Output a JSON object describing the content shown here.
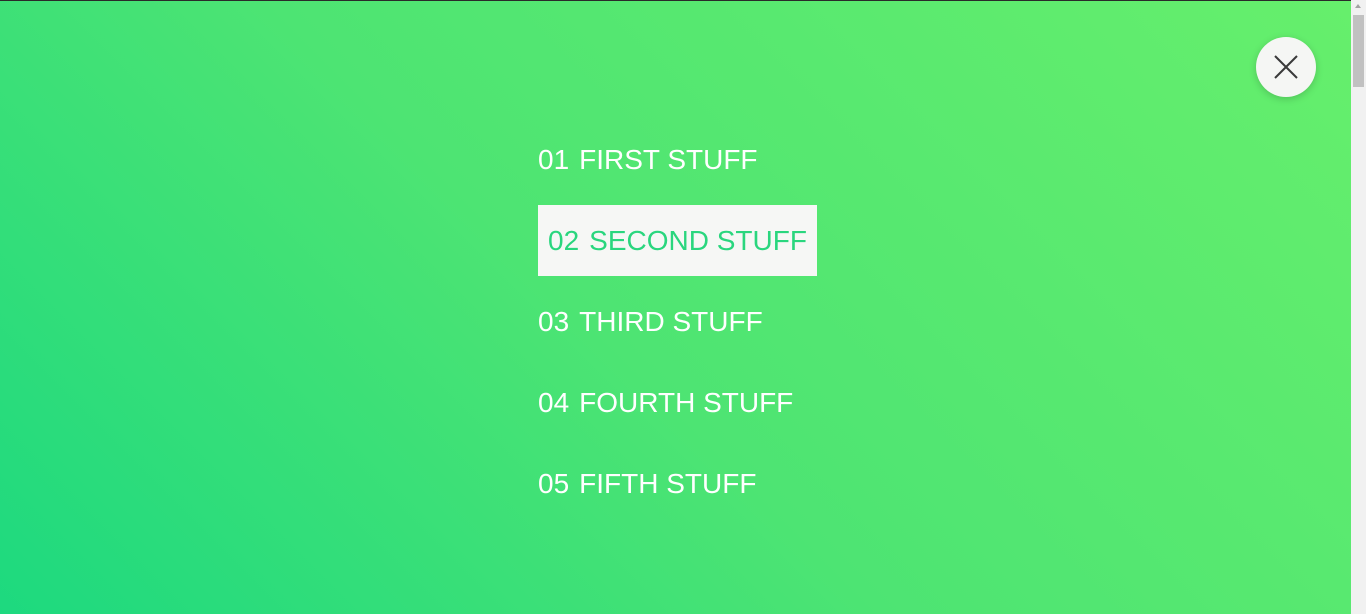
{
  "close": {
    "icon": "close-icon"
  },
  "menu": {
    "items": [
      {
        "number": "01",
        "label": "FIRST STUFF",
        "active": false
      },
      {
        "number": "02",
        "label": "SECOND STUFF",
        "active": true
      },
      {
        "number": "03",
        "label": "THIRD STUFF",
        "active": false
      },
      {
        "number": "04",
        "label": "FOURTH STUFF",
        "active": false
      },
      {
        "number": "05",
        "label": "FIFTH STUFF",
        "active": false
      }
    ]
  },
  "colors": {
    "gradient_start": "#1dd97f",
    "gradient_end": "#66ef6c",
    "active_bg": "#f6f7f5",
    "active_text": "#2ad67e",
    "text": "#ffffff"
  }
}
